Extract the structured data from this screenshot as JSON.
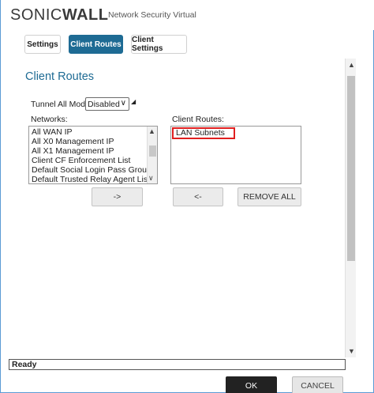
{
  "header": {
    "logo_text_a": "SONIC",
    "logo_text_b": "WALL",
    "product": "Network Security Virtual"
  },
  "tabs": [
    {
      "label": "Settings",
      "active": false
    },
    {
      "label": "Client Routes",
      "active": true
    },
    {
      "label": "Client Settings",
      "active": false
    }
  ],
  "section": {
    "title": "Client Routes"
  },
  "tunnel_mode": {
    "label": "Tunnel All Mode:",
    "value": "Disabled"
  },
  "networks": {
    "label": "Networks:",
    "items": [
      "All WAN IP",
      "All X0 Management IP",
      "All X1 Management IP",
      "Client CF Enforcement List",
      "Default Social Login Pass Group",
      "Default Trusted Relay Agent List"
    ]
  },
  "client_routes": {
    "label": "Client Routes:",
    "items": [
      "LAN Subnets"
    ]
  },
  "buttons": {
    "add": "->",
    "remove": "<-",
    "remove_all": "REMOVE ALL",
    "ok": "OK",
    "cancel": "CANCEL"
  },
  "status": "Ready",
  "colors": {
    "accent": "#1e6b94",
    "highlight": "#e02020",
    "frame": "#5b9bd5"
  }
}
